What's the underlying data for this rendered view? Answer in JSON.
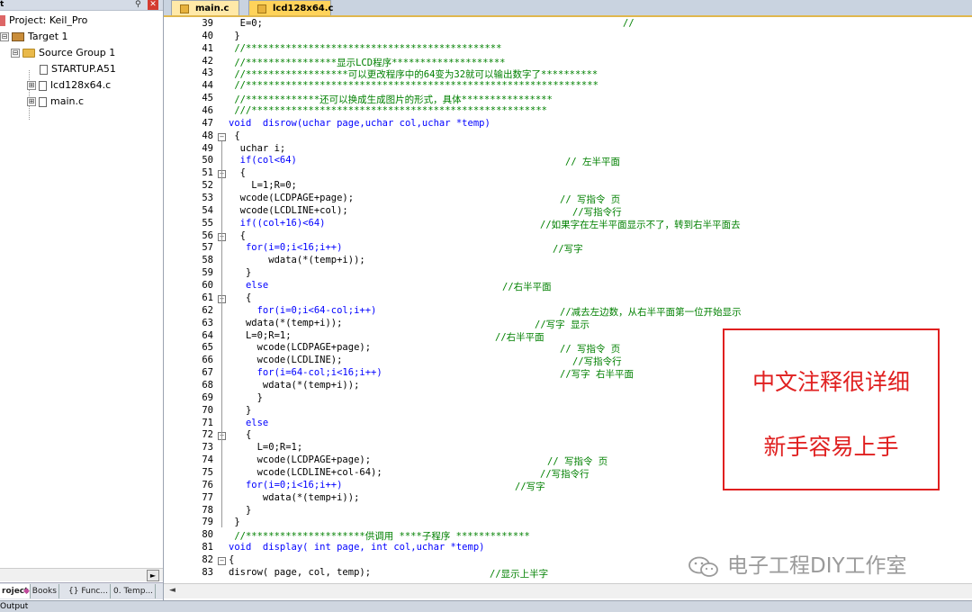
{
  "project_panel": {
    "title": "t",
    "pin": "⚲",
    "close": "✕",
    "tree": [
      {
        "label": "Project: Keil_Pro",
        "type": "project",
        "toggle": ""
      },
      {
        "label": "Target 1",
        "type": "target",
        "toggle": "⊟"
      },
      {
        "label": "Source Group 1",
        "type": "folder",
        "toggle": "⊟"
      },
      {
        "label": "STARTUP.A51",
        "type": "file",
        "toggle": ""
      },
      {
        "label": "lcd128x64.c",
        "type": "file",
        "toggle": "⊞"
      },
      {
        "label": "main.c",
        "type": "file",
        "toggle": "⊞"
      }
    ],
    "tabs": [
      {
        "label": "roject",
        "icon": "project-tab-icon"
      },
      {
        "label": "Books",
        "icon": "books-icon"
      },
      {
        "label": "Func...",
        "icon": "functions-icon"
      },
      {
        "label": "Temp...",
        "icon": "templates-icon"
      }
    ],
    "scroll_right": "►"
  },
  "output_label": "Output",
  "editor": {
    "tabs": [
      {
        "label": "main.c",
        "active": false
      },
      {
        "label": "lcd128x64.c",
        "active": true
      }
    ],
    "lines": [
      {
        "n": "39",
        "t": "  E=0;"
      },
      {
        "n": "40",
        "t": " }"
      },
      {
        "n": "41",
        "t": " //*********************************************"
      },
      {
        "n": "42",
        "t": " //****************显示LCD程序********************"
      },
      {
        "n": "43",
        "t": " //******************可以更改程序中的64变为32就可以输出数字了**********"
      },
      {
        "n": "44",
        "t": " //**************************************************************"
      },
      {
        "n": "45",
        "t": " //*************还可以换成生成图片的形式，具体****************"
      },
      {
        "n": "46",
        "t": " ///****************************************************"
      },
      {
        "n": "47",
        "t": "void  disrow(uchar page,uchar col,uchar *temp)"
      },
      {
        "n": "48",
        "t": " {"
      },
      {
        "n": "49",
        "t": "  uchar i;"
      },
      {
        "n": "50",
        "t": "  if(col<64)"
      },
      {
        "n": "51",
        "t": "  {"
      },
      {
        "n": "52",
        "t": "    L=1;R=0;"
      },
      {
        "n": "53",
        "t": "  wcode(LCDPAGE+page);"
      },
      {
        "n": "54",
        "t": "  wcode(LCDLINE+col);"
      },
      {
        "n": "55",
        "t": "  if((col+16)<64)"
      },
      {
        "n": "56",
        "t": "  {"
      },
      {
        "n": "57",
        "t": "   for(i=0;i<16;i++)"
      },
      {
        "n": "58",
        "t": "       wdata(*(temp+i));"
      },
      {
        "n": "59",
        "t": "   }"
      },
      {
        "n": "60",
        "t": "   else"
      },
      {
        "n": "61",
        "t": "   {"
      },
      {
        "n": "62",
        "t": "     for(i=0;i<64-col;i++)"
      },
      {
        "n": "63",
        "t": "   wdata(*(temp+i));"
      },
      {
        "n": "64",
        "t": "   L=0;R=1;"
      },
      {
        "n": "65",
        "t": "     wcode(LCDPAGE+page);"
      },
      {
        "n": "66",
        "t": "     wcode(LCDLINE);"
      },
      {
        "n": "67",
        "t": "     for(i=64-col;i<16;i++)"
      },
      {
        "n": "68",
        "t": "      wdata(*(temp+i));"
      },
      {
        "n": "69",
        "t": "     }"
      },
      {
        "n": "70",
        "t": "   }"
      },
      {
        "n": "71",
        "t": "   else"
      },
      {
        "n": "72",
        "t": "   {"
      },
      {
        "n": "73",
        "t": "     L=0;R=1;"
      },
      {
        "n": "74",
        "t": "     wcode(LCDPAGE+page);"
      },
      {
        "n": "75",
        "t": "     wcode(LCDLINE+col-64);"
      },
      {
        "n": "76",
        "t": "   for(i=0;i<16;i++)"
      },
      {
        "n": "77",
        "t": "      wdata(*(temp+i));"
      },
      {
        "n": "78",
        "t": "   }"
      },
      {
        "n": "79",
        "t": " }"
      },
      {
        "n": "80",
        "t": " //*********************供调用 ****子程序 *************"
      },
      {
        "n": "81",
        "t": "void  display( int page, int col,uchar *temp)"
      },
      {
        "n": "82",
        "t": "{"
      },
      {
        "n": "83",
        "t": "disrow( page, col, temp);"
      }
    ],
    "comments": [
      {
        "n": "39",
        "t": "//"
      },
      {
        "n": "50",
        "t": "// 左半平面"
      },
      {
        "n": "53",
        "t": "// 写指令 页"
      },
      {
        "n": "54",
        "t": "//写指令行"
      },
      {
        "n": "55",
        "t": "//如果字在左半平面显示不了，转到右半平面去"
      },
      {
        "n": "57",
        "t": "//写字"
      },
      {
        "n": "60",
        "t": "//右半平面"
      },
      {
        "n": "62",
        "t": "//减去左边数，从右半平面第一位开始显示"
      },
      {
        "n": "63",
        "t": "//写字 显示"
      },
      {
        "n": "64",
        "t": "//右半平面"
      },
      {
        "n": "65",
        "t": "// 写指令 页"
      },
      {
        "n": "66",
        "t": "//写指令行"
      },
      {
        "n": "67",
        "t": "//写字 右半平面"
      },
      {
        "n": "74",
        "t": "// 写指令 页"
      },
      {
        "n": "75",
        "t": "//写指令行"
      },
      {
        "n": "76",
        "t": "//写字"
      },
      {
        "n": "83",
        "t": "//显示上半字"
      }
    ],
    "scroll_left": "◄"
  },
  "annotation": {
    "line1": "中文注释很详细",
    "line2": "新手容易上手",
    "color": "#e02020"
  },
  "watermark": {
    "text": "电子工程DIY工作室",
    "icon": "wechat-icon"
  }
}
